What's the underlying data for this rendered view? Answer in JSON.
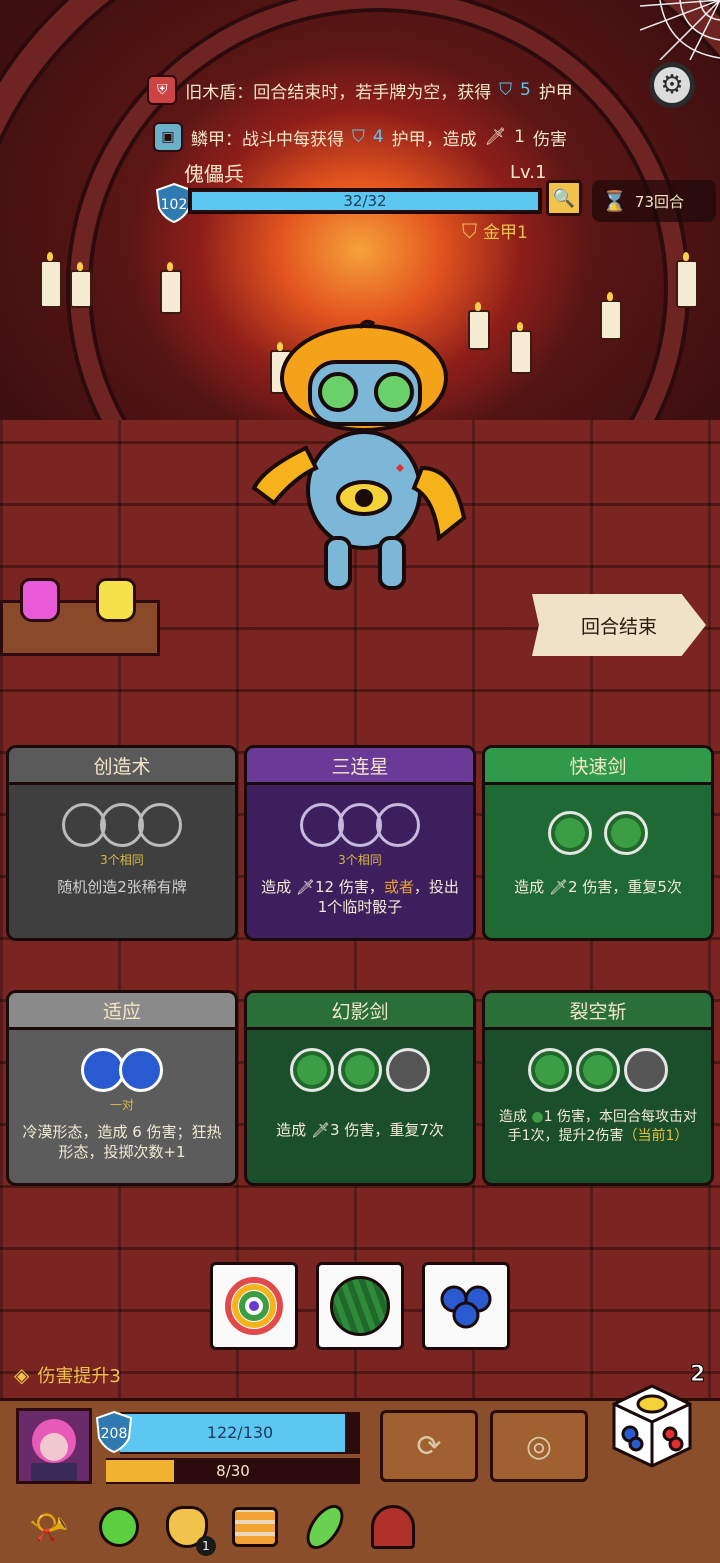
{
  "buffs": [
    {
      "icon": "shield-broken-icon",
      "text_a": "旧木盾：回合结束时，若手牌为空，获得",
      "num": "5",
      "text_b": "护甲"
    },
    {
      "icon": "scale-armor-icon",
      "text_a": "鳞甲：战斗中每获得",
      "num": "4",
      "text_b": "护甲，造成",
      "dmg": "1",
      "text_c": "伤害"
    }
  ],
  "enemy": {
    "name": "傀儡兵",
    "level": "Lv.1",
    "armor": "102",
    "armor_sub": "1",
    "hp_text": "32/32",
    "hp_fraction": 1.0,
    "status": "金甲1"
  },
  "turns": "73回合",
  "end_turn": "回合结束",
  "cards": [
    {
      "title": "创造术",
      "req": "3个相同",
      "desc": "随机创造2张稀有牌",
      "color": "gray"
    },
    {
      "title": "三连星",
      "req": "3个相同",
      "desc_a": "造成",
      "dmg": "12",
      "desc_b": "伤害，",
      "highlight": "或者",
      "desc_c": "，投出1个临时骰子",
      "color": "purple"
    },
    {
      "title": "快速剑",
      "req": "",
      "desc_a": "造成",
      "dmg": "2",
      "desc_b": "伤害，重复5次",
      "color": "green"
    },
    {
      "title": "适应",
      "req": "一对",
      "desc": "冷漠形态，造成 6 伤害；狂热形态，投掷次数+1",
      "color": "lgray"
    },
    {
      "title": "幻影剑",
      "req": "",
      "desc_a": "造成",
      "dmg": "3",
      "desc_b": "伤害，重复7次",
      "color": "dgreen"
    },
    {
      "title": "裂空斩",
      "req": "",
      "desc_a": "造成",
      "dmg": "1",
      "desc_b": "伤害，本回合每攻击对手1次，提升2伤害",
      "highlight": "（当前1）",
      "color": "dgreen"
    }
  ],
  "dice": [
    "rainbow-swirl-icon",
    "watermelon-icon",
    "blueberry-icon"
  ],
  "damage_up": "伤害提升3",
  "dice_remaining": "2",
  "player": {
    "armor": "208",
    "hp_text": "122/130",
    "hp_fraction": 0.938,
    "xp_text": "8/30",
    "xp_fraction": 0.267
  },
  "relics": [
    "horn-icon",
    "green-potion-icon",
    "coin-bag-icon",
    "sweater-icon",
    "feather-icon",
    "hood-icon"
  ],
  "relic_badge": "1"
}
